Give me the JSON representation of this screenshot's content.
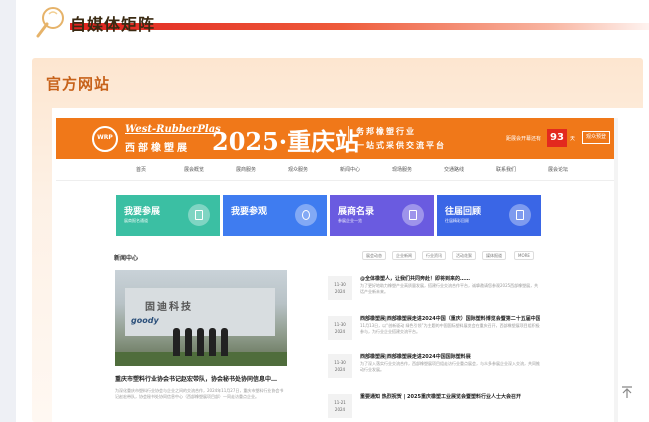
{
  "section": {
    "title": "自媒体矩阵"
  },
  "card": {
    "title": "官方网站"
  },
  "banner": {
    "logo_text": "WRP",
    "name_en": "West-RubberPlas",
    "name_cn": "西部橡塑展",
    "headline": "2025·重庆站",
    "slogan1": "务邦橡塑行业",
    "slogan2": "一站式采供交流平台",
    "countdown_label": "距展会开幕还有",
    "countdown_value": "93",
    "countdown_unit": "天",
    "cta": "观众预登"
  },
  "nav": [
    "首页",
    "展会概览",
    "展商服务",
    "观众服务",
    "新闻中心",
    "现场服务",
    "交通路线",
    "联系我们",
    "展会论坛"
  ],
  "tiles": [
    {
      "title": "我要参展",
      "sub": "展商报名通道",
      "color": "#3bbfa3"
    },
    {
      "title": "我要参观",
      "sub": "",
      "color": "#3f7cf0"
    },
    {
      "title": "展商名录",
      "sub": "参展企业一览",
      "color": "#6a5be0"
    },
    {
      "title": "往届回顾",
      "sub": "往届精彩回顾",
      "color": "#3a66e6"
    }
  ],
  "news": {
    "heading": "新闻中心",
    "tabs": [
      "展会动态",
      "企业新闻",
      "行业资讯",
      "活动花絮",
      "媒体报道",
      "MORE"
    ],
    "featured": {
      "title": "重庆市塑料行业协会书记赵宏带队，协会秘书处协同信息中…",
      "desc": "为深化重庆市塑料行业协会与企业之间的交流合作，2024年11月27日，重庆市塑料行业协会书记赵宏带队，协会秘书处协同信息中心（西部橡塑展项目部）一同走访重点企业。",
      "sign": "固迪科技",
      "sign2": "goody"
    },
    "items": [
      {
        "day": "11-30",
        "year": "2024",
        "title": "@全体橡塑人，让我们共同奔赴！即将到来的……",
        "desc": "为了更好地助力橡塑产业高质量发展，搭建行业交流合作平台，诚挚邀请您参观2025西部橡塑展，共话产业新未来。"
      },
      {
        "day": "11-30",
        "year": "2024",
        "title": "西部橡塑展|西部橡塑展走进2024中国（重庆）国际塑料博览会暨第二十五届中国塑料",
        "desc": "11月13日，以“创新驱动 绿色引领”为主题的中国国际塑料展览会在重庆召开，西部橡塑展项目组积极参与，为行业企业搭建交流平台。"
      },
      {
        "day": "11-30",
        "year": "2024",
        "title": "西部橡塑展|西部橡塑展走进2024中国国际塑料展",
        "desc": "为了深入落实行业交流合作，西部橡塑展项目组走访行业重点展会，与众多参展企业深入交流，共同推动行业发展。"
      },
      {
        "day": "11-21",
        "year": "2024",
        "title": "重要通知 热烈祝贺 | 2025重庆橡塑工业展览会暨塑料行业人士大会召开",
        "desc": ""
      }
    ]
  }
}
